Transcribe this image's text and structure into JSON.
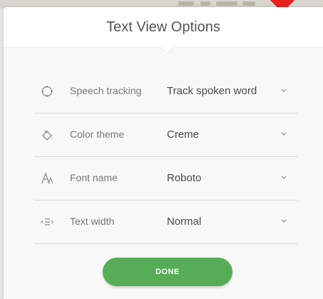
{
  "dialog": {
    "title": "Text View Options",
    "done_label": "DONE",
    "options": [
      {
        "label": "Speech tracking",
        "value": "Track spoken word",
        "icon": "speech-tracking-icon"
      },
      {
        "label": "Color theme",
        "value": "Creme",
        "icon": "paint-bucket-icon"
      },
      {
        "label": "Font name",
        "value": "Roboto",
        "icon": "font-icon"
      },
      {
        "label": "Text width",
        "value": "Normal",
        "icon": "text-width-icon"
      }
    ]
  },
  "colors": {
    "accent_button": "#57ad57",
    "pointer": "#e8211e",
    "panel_bg": "#f7f8f8"
  }
}
